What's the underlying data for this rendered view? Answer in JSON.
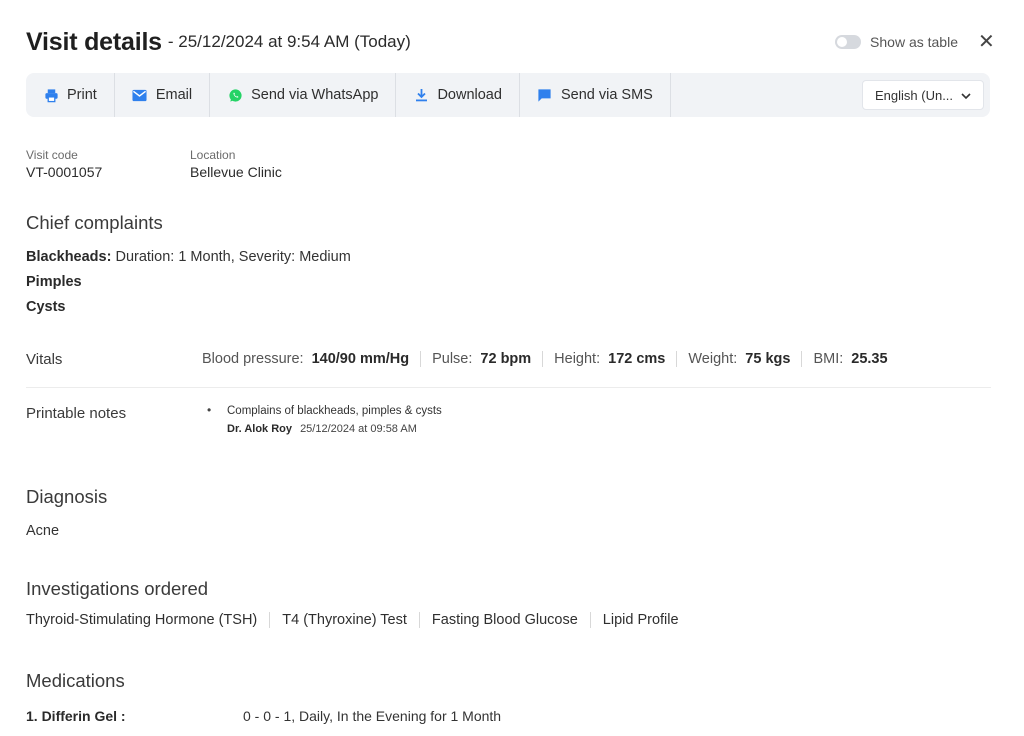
{
  "header": {
    "title": "Visit details",
    "date": "- 25/12/2024 at 9:54 AM (Today)",
    "toggle_label": "Show as table",
    "close": "✕"
  },
  "toolbar": {
    "print": "Print",
    "email": "Email",
    "whatsapp": "Send via WhatsApp",
    "download": "Download",
    "sms": "Send via SMS",
    "language": "English (Un...",
    "language_chevron": "⌄"
  },
  "meta": {
    "visit_code_label": "Visit code",
    "visit_code": "VT-0001057",
    "location_label": "Location",
    "location": "Bellevue Clinic"
  },
  "chief_complaints": {
    "title": "Chief complaints",
    "items": [
      {
        "name": "Blackheads:",
        "detail": "Duration: 1 Month, Severity: Medium"
      },
      {
        "name": "Pimples",
        "detail": ""
      },
      {
        "name": "Cysts",
        "detail": ""
      }
    ]
  },
  "vitals": {
    "title": "Vitals",
    "items": [
      {
        "label": "Blood pressure:",
        "value": "140/90 mm/Hg"
      },
      {
        "label": "Pulse:",
        "value": "72 bpm"
      },
      {
        "label": "Height:",
        "value": "172 cms"
      },
      {
        "label": "Weight:",
        "value": "75 kgs"
      },
      {
        "label": "BMI:",
        "value": "25.35"
      }
    ]
  },
  "notes": {
    "title": "Printable notes",
    "bullet": "•",
    "text": "Complains of blackheads, pimples & cysts",
    "author": "Dr. Alok Roy",
    "timestamp": "25/12/2024 at 09:58 AM"
  },
  "diagnosis": {
    "title": "Diagnosis",
    "value": "Acne"
  },
  "investigations": {
    "title": "Investigations ordered",
    "items": [
      "Thyroid-Stimulating Hormone (TSH)",
      "T4 (Thyroxine) Test",
      "Fasting Blood Glucose",
      "Lipid Profile"
    ]
  },
  "medications": {
    "title": "Medications",
    "items": [
      {
        "name": "1. Differin Gel :",
        "dosage": "0 - 0 - 1, Daily, In the Evening for 1 Month"
      }
    ]
  },
  "colors": {
    "whatsapp": "#25d366",
    "accent": "#2f80ed"
  }
}
